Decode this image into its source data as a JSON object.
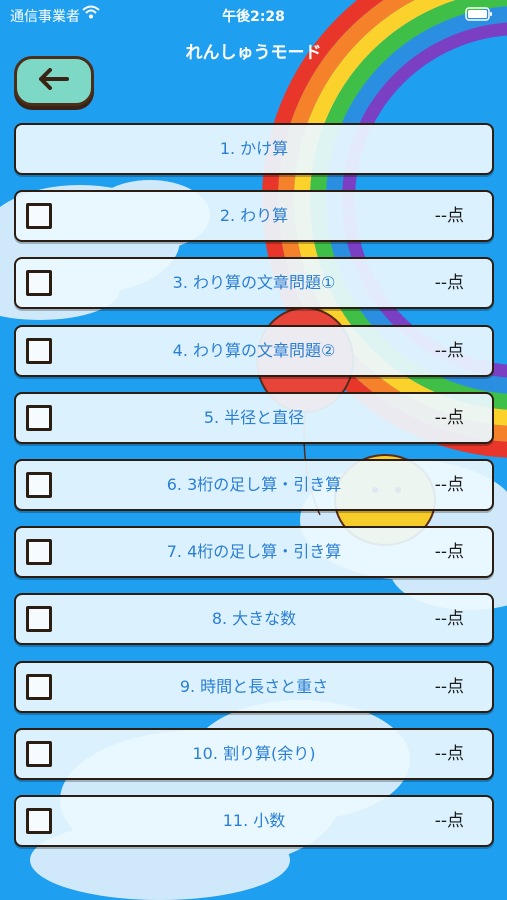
{
  "status_bar": {
    "carrier": "通信事業者",
    "time": "午後2:28",
    "wifi_icon": "wifi-icon",
    "battery_icon": "battery-icon"
  },
  "header": {
    "title": "れんしゅうモード",
    "back_icon": "arrow-left-icon"
  },
  "items": [
    {
      "label": "1. かけ算",
      "score": "",
      "has_checkbox": false
    },
    {
      "label": "2. わり算",
      "score": "--点",
      "has_checkbox": true
    },
    {
      "label": "3. わり算の文章問題①",
      "score": "--点",
      "has_checkbox": true
    },
    {
      "label": "4. わり算の文章問題②",
      "score": "--点",
      "has_checkbox": true
    },
    {
      "label": "5. 半径と直径",
      "score": "--点",
      "has_checkbox": true
    },
    {
      "label": "6. 3桁の足し算・引き算",
      "score": "--点",
      "has_checkbox": true
    },
    {
      "label": "7. 4桁の足し算・引き算",
      "score": "--点",
      "has_checkbox": true
    },
    {
      "label": "8. 大きな数",
      "score": "--点",
      "has_checkbox": true
    },
    {
      "label": "9. 時間と長さと重さ",
      "score": "--点",
      "has_checkbox": true
    },
    {
      "label": "10. 割り算(余り)",
      "score": "--点",
      "has_checkbox": true
    },
    {
      "label": "11. 小数",
      "score": "--点",
      "has_checkbox": true
    }
  ],
  "colors": {
    "background": "#1e9ff0",
    "label_text": "#2a7fd4",
    "back_button": "#7dd8c6"
  }
}
